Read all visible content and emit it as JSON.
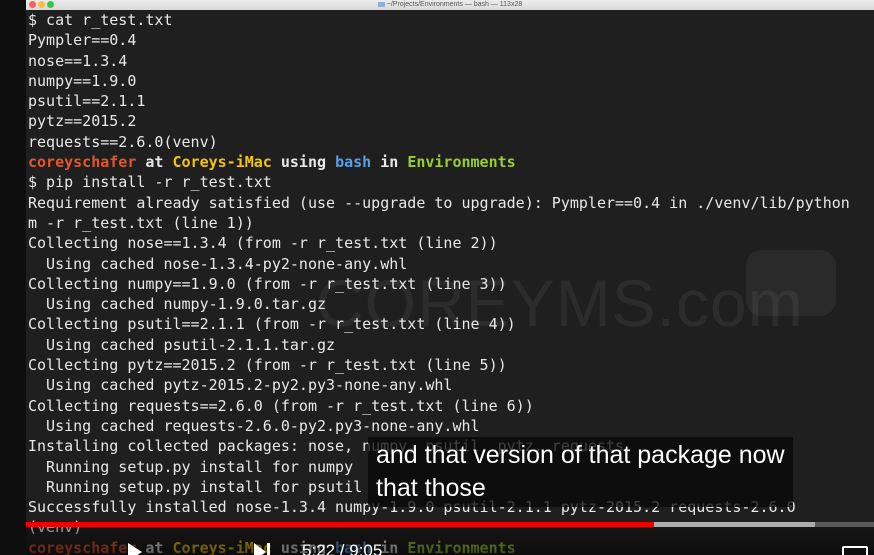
{
  "window": {
    "title": "~/Projects/Environments — bash — 113x28"
  },
  "terminal": {
    "lines": [
      [
        {
          "t": "$ cat r_test.txt",
          "c": "plain"
        }
      ],
      [
        {
          "t": "Pympler==0.4",
          "c": "plain"
        }
      ],
      [
        {
          "t": "nose==1.3.4",
          "c": "plain"
        }
      ],
      [
        {
          "t": "numpy==1.9.0",
          "c": "plain"
        }
      ],
      [
        {
          "t": "psutil==2.1.1",
          "c": "plain"
        }
      ],
      [
        {
          "t": "pytz==2015.2",
          "c": "plain"
        }
      ],
      [
        {
          "t": "requests==2.6.0(venv)",
          "c": "plain"
        }
      ],
      [
        {
          "t": "coreyschafer",
          "c": "user"
        },
        {
          "t": " at ",
          "c": "white"
        },
        {
          "t": "Coreys-iMac",
          "c": "host"
        },
        {
          "t": " using ",
          "c": "white"
        },
        {
          "t": "bash",
          "c": "shell"
        },
        {
          "t": " in ",
          "c": "white"
        },
        {
          "t": "Environments",
          "c": "dir"
        }
      ],
      [
        {
          "t": "$ pip install -r r_test.txt",
          "c": "plain"
        }
      ],
      [
        {
          "t": "Requirement already satisfied (use --upgrade to upgrade): Pympler==0.4 in ./venv/lib/python",
          "c": "plain"
        }
      ],
      [
        {
          "t": "m -r r_test.txt (line 1))",
          "c": "plain"
        }
      ],
      [
        {
          "t": "Collecting nose==1.3.4 (from -r r_test.txt (line 2))",
          "c": "plain"
        }
      ],
      [
        {
          "t": "  Using cached nose-1.3.4-py2-none-any.whl",
          "c": "plain"
        }
      ],
      [
        {
          "t": "Collecting numpy==1.9.0 (from -r r_test.txt (line 3))",
          "c": "plain"
        }
      ],
      [
        {
          "t": "  Using cached numpy-1.9.0.tar.gz",
          "c": "plain"
        }
      ],
      [
        {
          "t": "Collecting psutil==2.1.1 (from -r r_test.txt (line 4))",
          "c": "plain"
        }
      ],
      [
        {
          "t": "  Using cached psutil-2.1.1.tar.gz",
          "c": "plain"
        }
      ],
      [
        {
          "t": "Collecting pytz==2015.2 (from -r r_test.txt (line 5))",
          "c": "plain"
        }
      ],
      [
        {
          "t": "  Using cached pytz-2015.2-py2.py3-none-any.whl",
          "c": "plain"
        }
      ],
      [
        {
          "t": "Collecting requests==2.6.0 (from -r r_test.txt (line 6))",
          "c": "plain"
        }
      ],
      [
        {
          "t": "  Using cached requests-2.6.0-py2.py3-none-any.whl",
          "c": "plain"
        }
      ],
      [
        {
          "t": "Installing collected packages: nose, numpy, psutil, pytz, requests",
          "c": "plain"
        }
      ],
      [
        {
          "t": "  Running setup.py install for numpy",
          "c": "plain"
        }
      ],
      [
        {
          "t": "  Running setup.py install for psutil",
          "c": "plain"
        }
      ],
      [
        {
          "t": "Successfully installed nose-1.3.4 numpy-1.9.0 psutil-2.1.1 pytz-2015.2 requests-2.6.0",
          "c": "plain"
        }
      ],
      [
        {
          "t": "(venv)",
          "c": "plain"
        }
      ],
      [
        {
          "t": "coreyschafer",
          "c": "user"
        },
        {
          "t": " at ",
          "c": "white"
        },
        {
          "t": "Coreys-iMac",
          "c": "host"
        },
        {
          "t": " using ",
          "c": "white"
        },
        {
          "t": "bash",
          "c": "shell"
        },
        {
          "t": " in ",
          "c": "white"
        },
        {
          "t": "Environments",
          "c": "dir"
        }
      ]
    ]
  },
  "watermark": {
    "text": "COREYMS.com"
  },
  "caption": {
    "line1": "and that version of that package now",
    "line2": "that those"
  },
  "player": {
    "progress_played": 0.74,
    "progress_buffered": 0.93,
    "time_text": "5:22 / 9:05",
    "icons": [
      "play-icon",
      "next-icon",
      "fullscreen-icon"
    ]
  },
  "colors": {
    "user": "#e4572e",
    "host": "#f1c40f",
    "shell": "#5aa0e6",
    "dir": "#9acd32",
    "progress": "#e00000"
  }
}
